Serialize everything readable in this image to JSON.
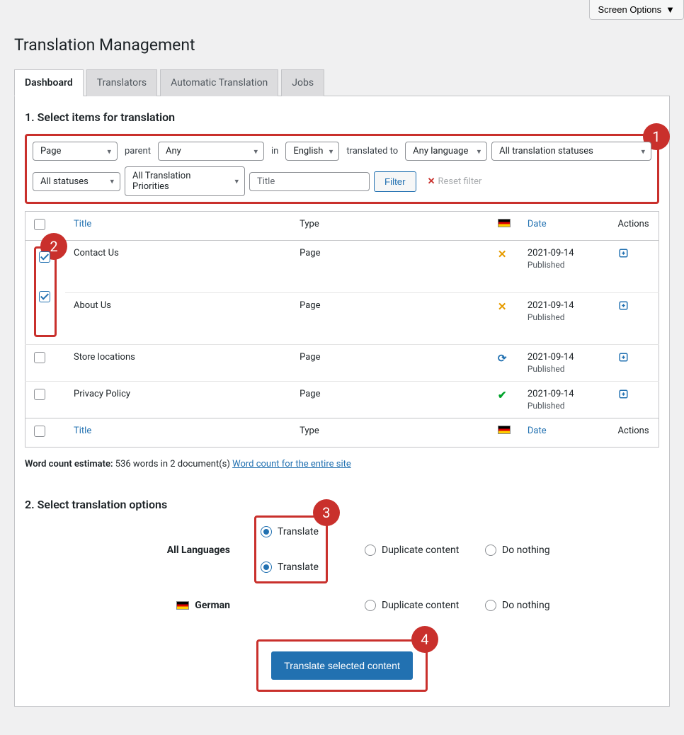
{
  "screenOptions": "Screen Options",
  "pageTitle": "Translation Management",
  "tabs": {
    "dashboard": "Dashboard",
    "translators": "Translators",
    "automatic": "Automatic Translation",
    "jobs": "Jobs"
  },
  "section1": "1. Select items for translation",
  "filters": {
    "type": "Page",
    "parentLabel": "parent",
    "parent": "Any",
    "inLabel": "in",
    "language": "English",
    "translatedToLabel": "translated to",
    "toLang": "Any language",
    "status": "All translation statuses",
    "allStatuses": "All statuses",
    "priorities": "All Translation Priorities",
    "titlePlaceholder": "Title",
    "filterBtn": "Filter",
    "resetBtn": "Reset filter"
  },
  "steps": {
    "s1": "1",
    "s2": "2",
    "s3": "3",
    "s4": "4"
  },
  "columns": {
    "title": "Title",
    "type": "Type",
    "date": "Date",
    "actions": "Actions"
  },
  "rows": [
    {
      "title": "Contact Us",
      "type": "Page",
      "status": "x",
      "date": "2021-09-14",
      "state": "Published",
      "checked": true
    },
    {
      "title": "About Us",
      "type": "Page",
      "status": "x",
      "date": "2021-09-14",
      "state": "Published",
      "checked": true
    },
    {
      "title": "Store locations",
      "type": "Page",
      "status": "refresh",
      "date": "2021-09-14",
      "state": "Published",
      "checked": false
    },
    {
      "title": "Privacy Policy",
      "type": "Page",
      "status": "check",
      "date": "2021-09-14",
      "state": "Published",
      "checked": false
    }
  ],
  "wordCount": {
    "label": "Word count estimate:",
    "text": "536 words in 2 document(s)",
    "link": "Word count for the entire site"
  },
  "section2": "2. Select translation options",
  "options": {
    "allLanguages": "All Languages",
    "german": "German",
    "translate": "Translate",
    "duplicate": "Duplicate content",
    "nothing": "Do nothing"
  },
  "submit": "Translate selected content"
}
